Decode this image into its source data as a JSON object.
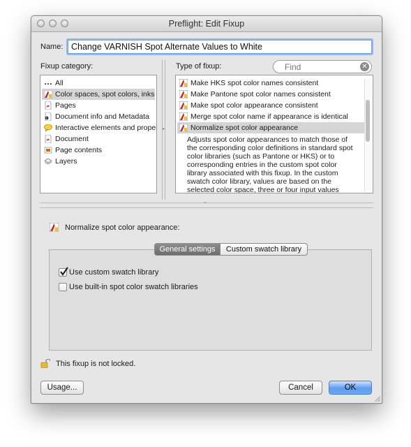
{
  "window": {
    "title": "Preflight: Edit Fixup"
  },
  "name_label": "Name:",
  "name_value": "Change VARNISH Spot Alternate Values to White",
  "fixup_category": {
    "label": "Fixup category:",
    "items": [
      {
        "label": "All",
        "icon": "dots-icon"
      },
      {
        "label": "Color spaces, spot colors, inks",
        "icon": "color-spaces-icon",
        "selected": true
      },
      {
        "label": "Pages",
        "icon": "pdf-icon"
      },
      {
        "label": "Document info and Metadata",
        "icon": "document-info-icon"
      },
      {
        "label": "Interactive elements and properties",
        "icon": "interactive-icon"
      },
      {
        "label": "Document",
        "icon": "pdf-icon"
      },
      {
        "label": "Page contents",
        "icon": "page-contents-icon"
      },
      {
        "label": "Layers",
        "icon": "layers-icon"
      }
    ]
  },
  "type_of_fixup": {
    "label": "Type of fixup:",
    "search_placeholder": "Find",
    "items": [
      {
        "label": "Make HKS spot color names consistent"
      },
      {
        "label": "Make Pantone spot color names consistent"
      },
      {
        "label": "Make spot color appearance consistent"
      },
      {
        "label": "Merge spot color name if appearance is identical"
      },
      {
        "label": "Normalize spot color appearance",
        "selected": true
      }
    ],
    "description": "Adjusts spot color appearances to match those of the corresponding color definitions in standard spot color libraries (such as Pantone or HKS) or to corresponding entries in the custom spot color library associated with this fixup. In the custom swatch color library, values are based on the selected color space, three or four input values"
  },
  "settings": {
    "heading": "Normalize spot color appearance:",
    "tabs": [
      {
        "label": "General settings",
        "active": true
      },
      {
        "label": "Custom swatch library",
        "active": false
      }
    ],
    "use_custom_label": "Use custom swatch library",
    "use_custom_checked": true,
    "use_builtin_label": "Use built-in spot color swatch libraries",
    "use_builtin_checked": false
  },
  "lock_status": "This fixup is not locked.",
  "buttons": {
    "usage": "Usage...",
    "cancel": "Cancel",
    "ok": "OK"
  },
  "colors": {
    "ok_blue": "#5e9cf0",
    "selection": "#d5d5d5",
    "focus_ring": "#94b8ea"
  }
}
